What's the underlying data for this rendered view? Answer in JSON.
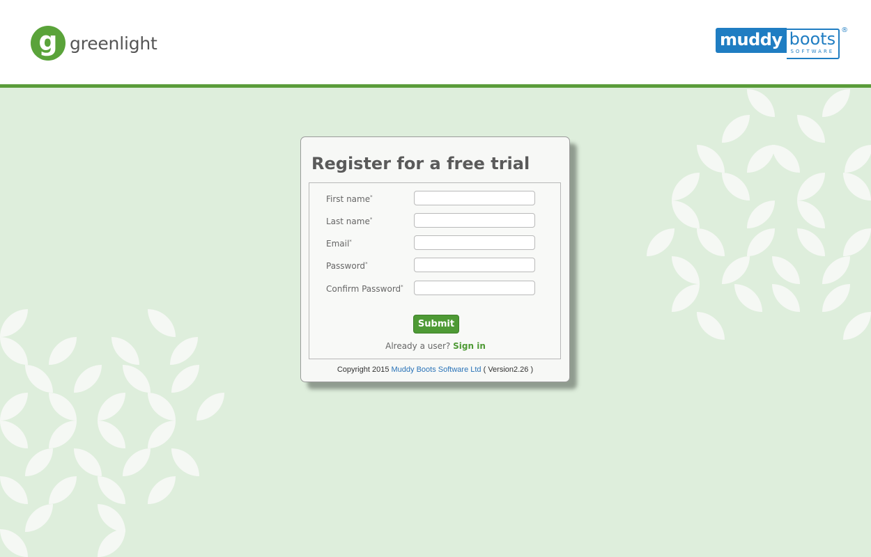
{
  "header": {
    "left_logo": {
      "mark": "g",
      "word": "greenlight"
    },
    "right_logo": {
      "part1": "muddy",
      "part2": "boots",
      "tagline": "SOFTWARE",
      "registered": "®"
    }
  },
  "form": {
    "title": "Register for a free trial",
    "fields": [
      {
        "label": "First name",
        "required_mark": "*",
        "value": ""
      },
      {
        "label": "Last name",
        "required_mark": "*",
        "value": ""
      },
      {
        "label": "Email",
        "required_mark": "*",
        "value": ""
      },
      {
        "label": "Password",
        "required_mark": "*",
        "value": ""
      },
      {
        "label": "Confirm Password",
        "required_mark": "*",
        "value": ""
      }
    ],
    "submit_label": "Submit",
    "signin_prompt": "Already a user?",
    "signin_link": "Sign in"
  },
  "footer": {
    "copyright_prefix": "Copyright 2015",
    "company_link": "Muddy Boots Software Ltd",
    "version_text": "( Version2.26 )"
  },
  "colors": {
    "brand_green": "#5a9c3a",
    "background": "#deeedc",
    "link_blue": "#2a73b8"
  }
}
